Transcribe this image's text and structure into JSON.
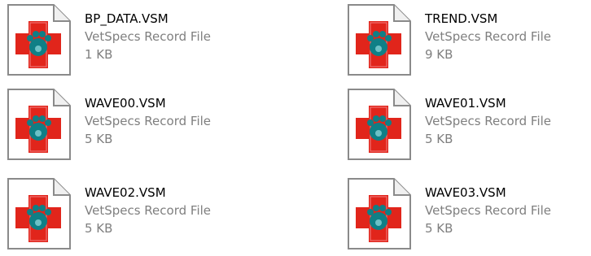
{
  "files": [
    {
      "name": "BP_DATA.VSM",
      "type": "VetSpecs Record File",
      "size": "1 KB"
    },
    {
      "name": "TREND.VSM",
      "type": "VetSpecs Record File",
      "size": "9 KB"
    },
    {
      "name": "WAVE00.VSM",
      "type": "VetSpecs Record File",
      "size": "5 KB"
    },
    {
      "name": "WAVE01.VSM",
      "type": "VetSpecs Record File",
      "size": "5 KB"
    },
    {
      "name": "WAVE02.VSM",
      "type": "VetSpecs Record File",
      "size": "5 KB"
    },
    {
      "name": "WAVE03.VSM",
      "type": "VetSpecs Record File",
      "size": "5 KB"
    }
  ],
  "icon": {
    "name": "vetspecs-file-icon",
    "cross_color": "#e1251b",
    "paw_color": "#0f7f86",
    "page_color": "#ffffff",
    "page_border_color": "#8a8a8a"
  }
}
